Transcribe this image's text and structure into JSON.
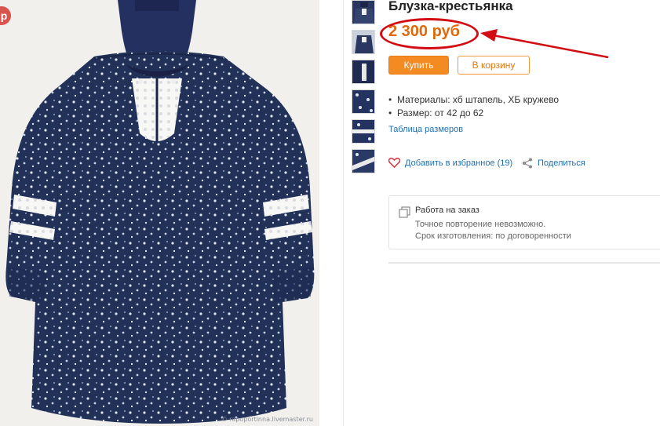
{
  "product": {
    "title": "Блузка-крестьянка",
    "price": "2 300 руб"
  },
  "actions": {
    "buy_label": "Купить",
    "cart_label": "В корзину"
  },
  "specs": [
    "Материалы:  хб штапель, ХБ кружево",
    "Размер:  от 42 до 62"
  ],
  "size_table_link": "Таблица размеров",
  "favorite": {
    "label": "Добавить в избранное (19)"
  },
  "share": {
    "label": "Поделиться"
  },
  "made_to_order": {
    "title": "Работа на заказ",
    "line1": "Точное повторение невозможно.",
    "line2": "Срок изготовления: по договоренности"
  },
  "photo": {
    "watermark": "© rapoportinna.livemaster.ru"
  },
  "colors": {
    "price": "#e06a0a",
    "buy_button": "#f38a22",
    "link": "#1f6fb2",
    "annotation": "#d10c12",
    "fabric": "#223158"
  },
  "thumbnails_count": 6
}
